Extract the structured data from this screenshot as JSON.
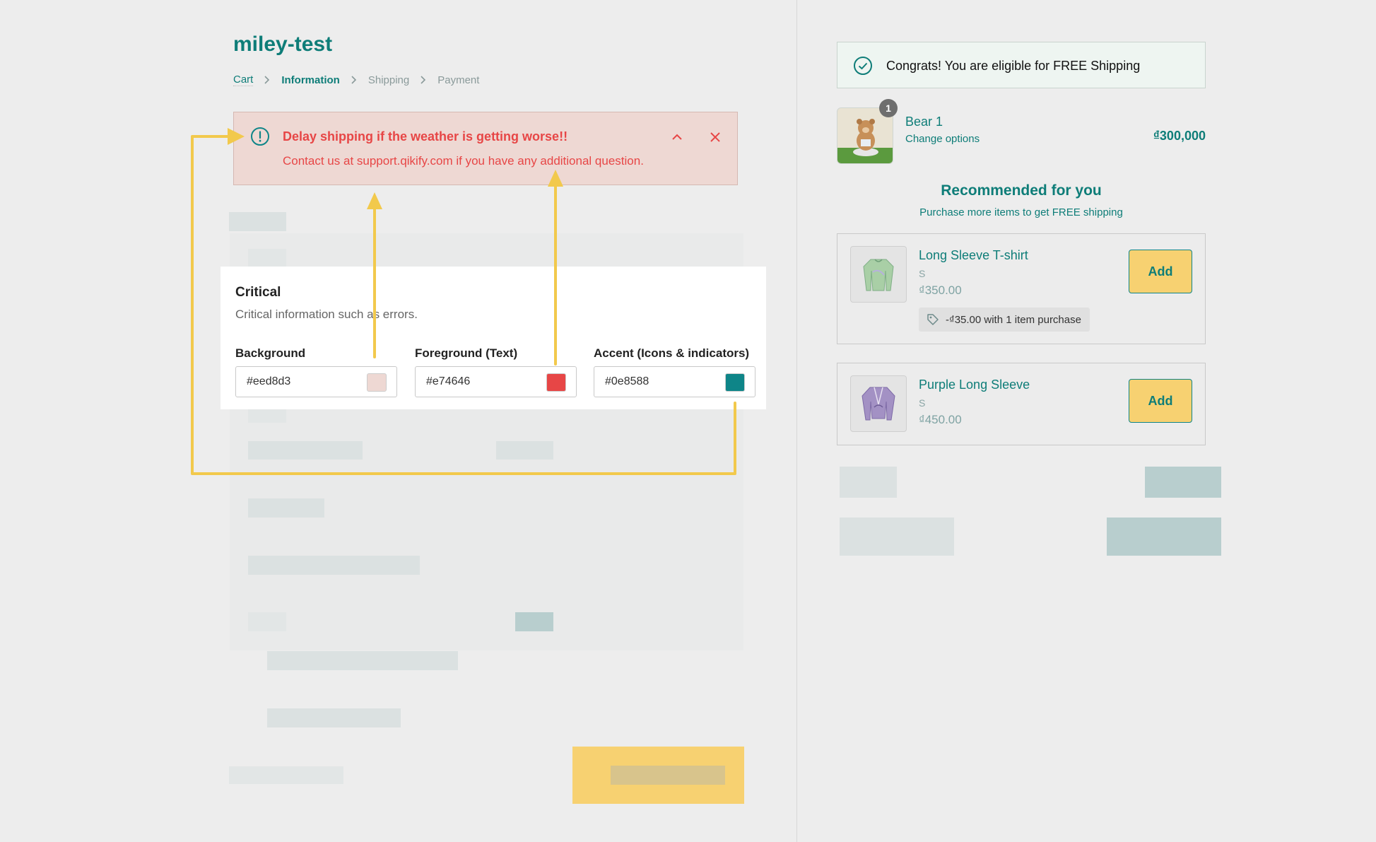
{
  "store": {
    "title": "miley-test"
  },
  "breadcrumb": {
    "items": [
      "Cart",
      "Information",
      "Shipping",
      "Payment"
    ]
  },
  "alert": {
    "title": "Delay shipping if the weather is getting worse!!",
    "message": "Contact us at support.qikify.com if you have any additional question.",
    "icon": "alert-circle-icon",
    "collapse_icon": "chevron-up-icon",
    "close_icon": "close-icon"
  },
  "settings": {
    "heading": "Critical",
    "description": "Critical information such as errors.",
    "fields": [
      {
        "label": "Background",
        "value": "#eed8d3",
        "swatch": "#eed8d3"
      },
      {
        "label": "Foreground (Text)",
        "value": "#e74646",
        "swatch": "#e74646"
      },
      {
        "label": "Accent (Icons & indicators)",
        "value": "#0e8588",
        "swatch": "#0e8588"
      }
    ]
  },
  "shipping_banner": {
    "text": "Congrats! You are eligible for FREE Shipping",
    "icon": "check-circle-icon"
  },
  "cart": {
    "items": [
      {
        "quantity": "1",
        "name": "Bear 1",
        "options_link": "Change options",
        "price": "₫300,000"
      }
    ]
  },
  "recommendations": {
    "title": "Recommended for you",
    "subtitle": "Purchase more items to get FREE shipping",
    "items": [
      {
        "name": "Long Sleeve T-shirt",
        "variant": "S",
        "price": "₫350.00",
        "button": "Add",
        "discount": "-₫35.00 with 1 item purchase"
      },
      {
        "name": "Purple Long Sleeve",
        "variant": "S",
        "price": "₫450.00",
        "button": "Add"
      }
    ]
  },
  "colors": {
    "accent": "#0e7d78",
    "alert_bg": "#eed8d3",
    "alert_text": "#e74646",
    "accent_icons": "#0e8588",
    "button": "#f7d171",
    "annotation_arrow": "#f2c94c"
  }
}
